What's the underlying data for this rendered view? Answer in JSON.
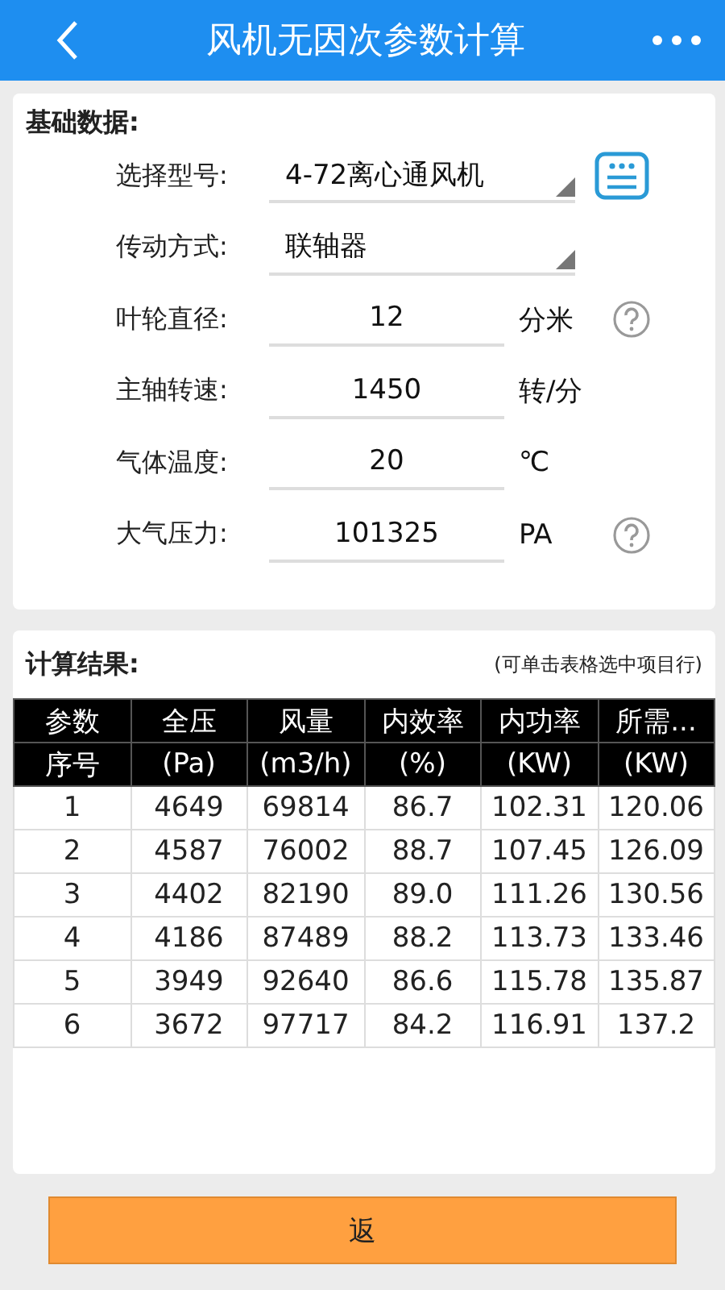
{
  "header": {
    "title": "风机无因次参数计算"
  },
  "basic": {
    "title": "基础数据:",
    "fields": [
      {
        "kind": "select",
        "label": "选择型号:",
        "value": "4-72离心通风机",
        "list_button": true,
        "help": false
      },
      {
        "kind": "select",
        "label": "传动方式:",
        "value": "联轴器",
        "list_button": false,
        "help": false
      },
      {
        "kind": "input",
        "label": "叶轮直径:",
        "value": "12",
        "unit": "分米",
        "help": true
      },
      {
        "kind": "input",
        "label": "主轴转速:",
        "value": "1450",
        "unit": "转/分",
        "help": false
      },
      {
        "kind": "input",
        "label": "气体温度:",
        "value": "20",
        "unit": "℃",
        "help": false
      },
      {
        "kind": "input",
        "label": "大气压力:",
        "value": "101325",
        "unit": "PA",
        "help": true
      }
    ]
  },
  "results": {
    "title": "计算结果:",
    "hint": "(可单击表格选中项目行)",
    "table": {
      "header_rows": [
        [
          "参数",
          "全压",
          "风量",
          "内效率",
          "内功率",
          "所需..."
        ],
        [
          "序号",
          "(Pa)",
          "(m3/h)",
          "(%)",
          "(KW)",
          "(KW)"
        ]
      ],
      "rows": [
        [
          "1",
          "4649",
          "69814",
          "86.7",
          "102.31",
          "120.06"
        ],
        [
          "2",
          "4587",
          "76002",
          "88.7",
          "107.45",
          "126.09"
        ],
        [
          "3",
          "4402",
          "82190",
          "89.0",
          "111.26",
          "130.56"
        ],
        [
          "4",
          "4186",
          "87489",
          "88.2",
          "113.73",
          "133.46"
        ],
        [
          "5",
          "3949",
          "92640",
          "86.6",
          "115.78",
          "135.87"
        ],
        [
          "6",
          "3672",
          "97717",
          "84.2",
          "116.91",
          "137.2"
        ]
      ]
    }
  },
  "footer": {
    "button": "返"
  }
}
